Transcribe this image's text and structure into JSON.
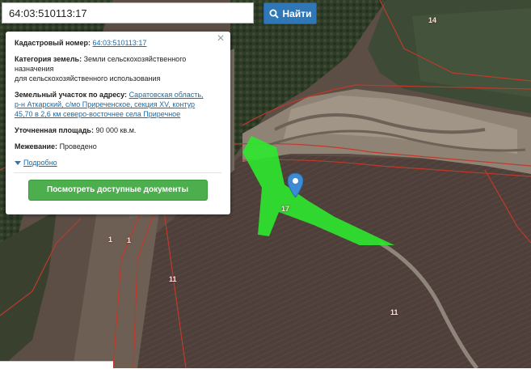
{
  "search": {
    "value": "64:03:510113:17",
    "button_label": "Найти"
  },
  "popup": {
    "cadastral_label": "Кадастровый номер:",
    "cadastral_value": "64:03:510113:17",
    "category_label": "Категория земель:",
    "category_value": "Земли сельскохозяйственного назначения",
    "category_value2": "для сельскохозяйственного использования",
    "address_label": "Земельный участок по адресу:",
    "address_link1": "Саратовская область,",
    "address_link2": "р-н Аткарский, с/мо Приреченское, секция XV, контур",
    "address_link3": "45,70 в 2,6 км северо-восточнее села Приречное",
    "area_label": "Уточненная площадь:",
    "area_value": "90 000 кв.м.",
    "survey_label": "Межевание:",
    "survey_value": "Проведено",
    "more_label": "Подробно",
    "docs_button": "Посмотреть доступные документы",
    "close_symbol": "×"
  },
  "map": {
    "parcel_labels": [
      "14",
      "17",
      "1",
      "1",
      "11",
      "11"
    ],
    "colors": {
      "parcel_fill": "#2ee82e",
      "boundary": "#c0392b",
      "marker": "#3d8bd4"
    }
  }
}
